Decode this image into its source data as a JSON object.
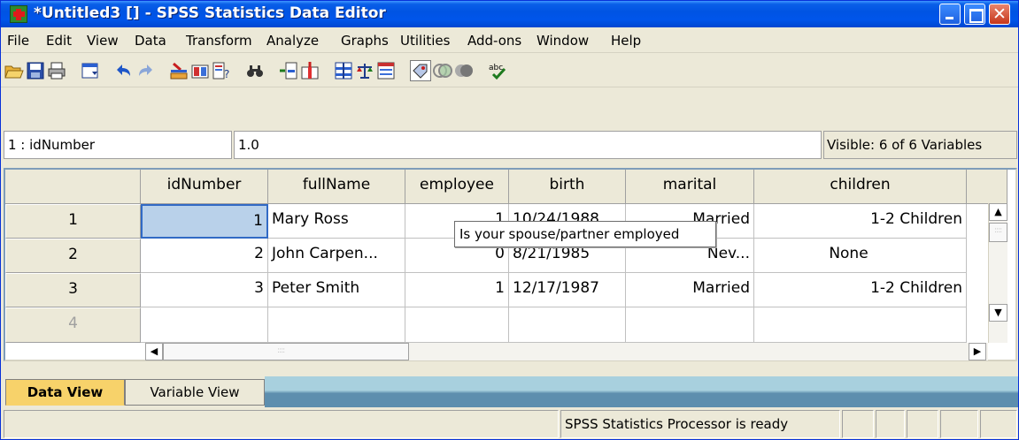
{
  "window": {
    "title": "*Untitled3 [] - SPSS Statistics Data Editor"
  },
  "menu": [
    "File",
    "Edit",
    "View",
    "Data",
    "Transform",
    "Analyze",
    "Graphs",
    "Utilities",
    "Add-ons",
    "Window",
    "Help"
  ],
  "toolbar": {
    "icons": [
      "open-folder-icon",
      "save-icon",
      "print-icon",
      "dialog-recall-icon",
      "undo-icon",
      "redo-icon",
      "goto-case-icon",
      "goto-variable-icon",
      "variables-icon",
      "find-icon",
      "insert-cases-icon",
      "insert-variable-icon",
      "split-file-icon",
      "weight-cases-icon",
      "select-cases-icon",
      "value-labels-icon",
      "use-sets-icon",
      "show-all-variables-icon",
      "spell-check-icon"
    ]
  },
  "cell_editor": {
    "cell_ref": "1 : idNumber",
    "value": "1.0",
    "visible": "Visible: 6 of 6 Variables"
  },
  "grid": {
    "columns": [
      "idNumber",
      "fullName",
      "employee",
      "birth",
      "marital",
      "children"
    ],
    "rows": [
      {
        "row": "1",
        "idNumber": "1",
        "fullName": "Mary Ross",
        "employee": "1",
        "birth": "10/24/1988",
        "marital": "Married",
        "children": "1-2 Children"
      },
      {
        "row": "2",
        "idNumber": "2",
        "fullName": "John Carpen...",
        "employee": "0",
        "birth": "8/21/1985",
        "marital": "Nev...",
        "children": "None"
      },
      {
        "row": "3",
        "idNumber": "3",
        "fullName": "Peter Smith",
        "employee": "1",
        "birth": "12/17/1987",
        "marital": "Married",
        "children": "1-2 Children"
      },
      {
        "row": "4",
        "idNumber": "",
        "fullName": "",
        "employee": "",
        "birth": "",
        "marital": "",
        "children": ""
      }
    ]
  },
  "tooltip": "Is your spouse/partner employed",
  "tabs": {
    "data_view": "Data View",
    "variable_view": "Variable View"
  },
  "status": {
    "message": "SPSS Statistics  Processor is ready"
  }
}
